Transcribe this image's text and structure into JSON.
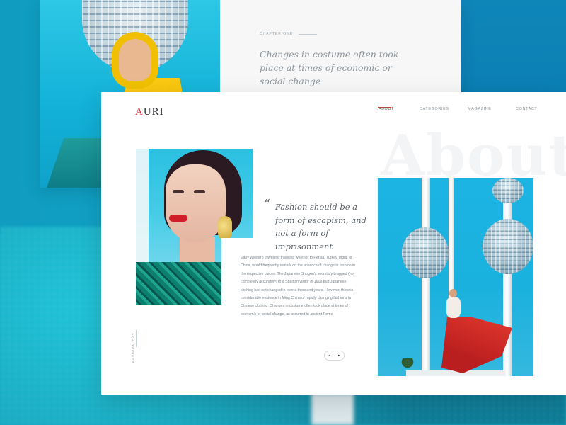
{
  "back_card": {
    "chapter": "CHAPTER ONE",
    "quote": "Changes in costume often took place at times of economic or social change"
  },
  "brand": {
    "logo_first": "A",
    "logo_rest": "URI",
    "accent": "#d33333"
  },
  "nav": {
    "items": [
      {
        "label": "ABOUT",
        "active": true
      },
      {
        "label": "CATEGORIES",
        "active": false
      },
      {
        "label": "MAGAZINE",
        "active": false
      },
      {
        "label": "CONTACT",
        "active": false
      }
    ],
    "indicator_color": "#e03c3c"
  },
  "hero": {
    "watermark": "About",
    "quote": "Fashion should be a form of escapism, and not a form of imprisonment",
    "quote_mark": "“",
    "body": "Early Western travelers, traveling whether to Persia, Turkey, India, or China, would frequently remark on the absence of change in fashion in the respective places. The Japanese Shogun's secretary bragged (not completely accurately) to a Spanish visitor in 1609 that Japanese clothing had not changed in over a thousand years. However, there is considerable evidence in Ming China of rapidly changing fashions in Chinese clothing. Changes in costume often took place at times of economic or social change, as occurred in ancient Rome",
    "side_label": "FASHION DAY"
  },
  "pager": {
    "prev_icon": "chevron-left-icon",
    "next_icon": "chevron-right-icon",
    "prev_glyph": "◂",
    "next_glyph": "▸"
  }
}
